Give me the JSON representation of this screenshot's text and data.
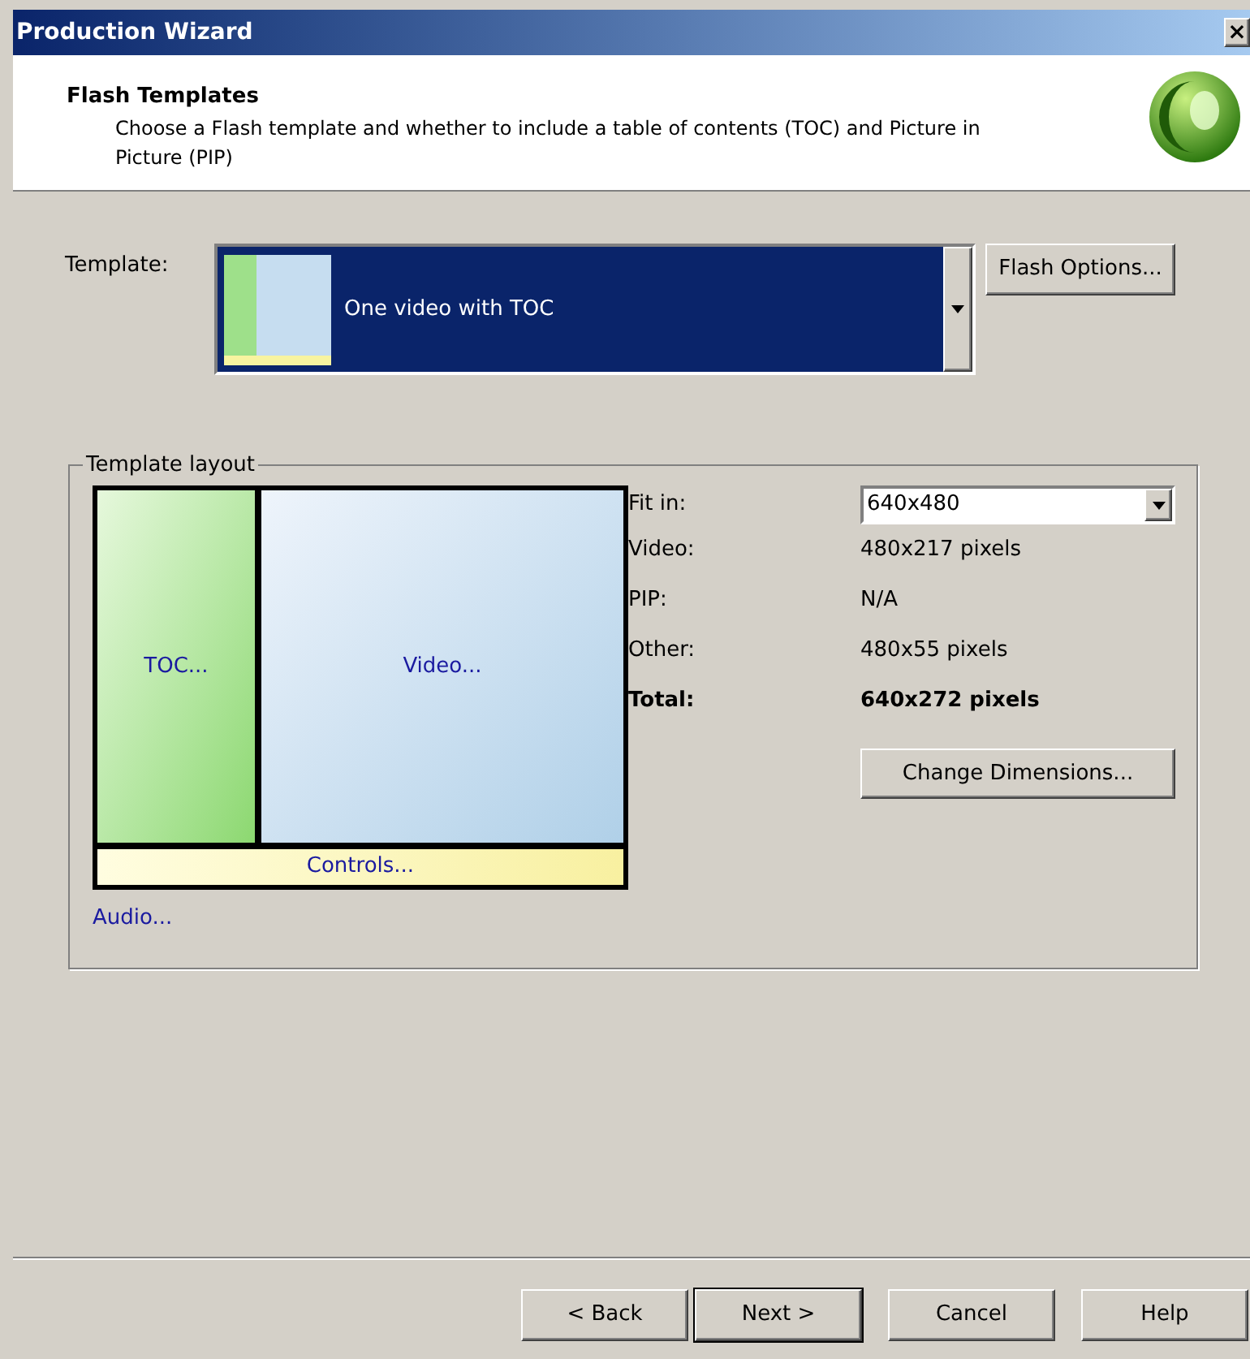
{
  "window": {
    "title": "Production Wizard",
    "close": "×"
  },
  "header": {
    "title": "Flash Templates",
    "description": "Choose a Flash template and whether to include a table of contents (TOC) and Picture in Picture (PIP)"
  },
  "template": {
    "label": "Template:",
    "value": "One video with TOC",
    "button": "Flash Options..."
  },
  "layout": {
    "legend": "Template layout",
    "toc": "TOC...",
    "video": "Video...",
    "controls": "Controls...",
    "audio": "Audio...",
    "fit_label": "Fit in:",
    "fit_value": "640x480",
    "rows": [
      {
        "label": "Video:",
        "value": "480x217 pixels",
        "bold": false
      },
      {
        "label": "PIP:",
        "value": "N/A",
        "bold": false
      },
      {
        "label": "Other:",
        "value": "480x55 pixels",
        "bold": false
      },
      {
        "label": "Total:",
        "value": "640x272 pixels",
        "bold": true
      }
    ],
    "button": "Change Dimensions..."
  },
  "buttons": [
    {
      "label": "< Back",
      "default": false
    },
    {
      "label": "Next >",
      "default": true
    },
    {
      "label": "Cancel",
      "default": false
    },
    {
      "label": "Help",
      "default": false
    }
  ]
}
